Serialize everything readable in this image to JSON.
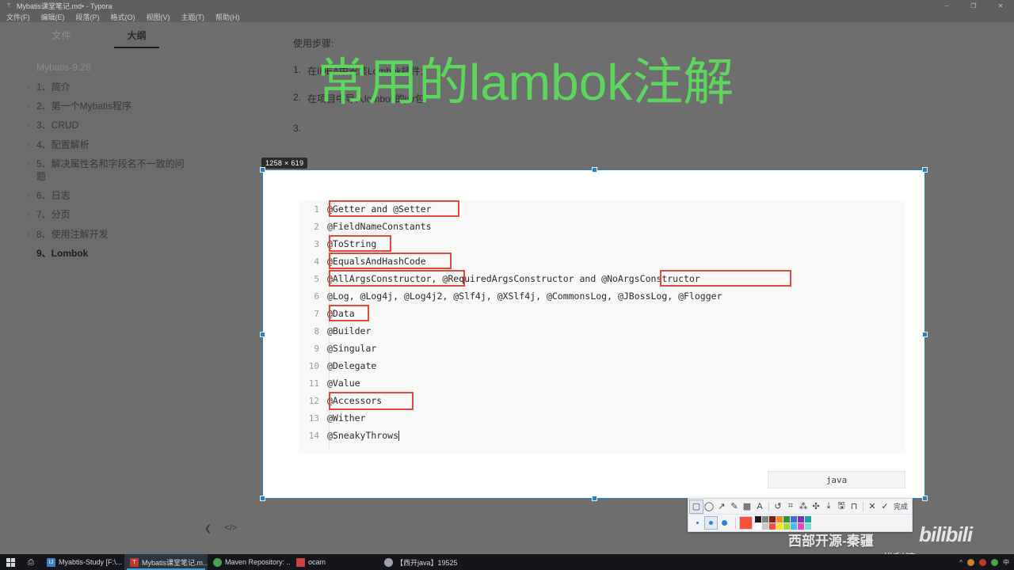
{
  "window": {
    "title": "Mybatis课堂笔记.md• - Typora",
    "app_icon": "typora-icon",
    "minimize": "–",
    "maximize": "❐",
    "close": "✕",
    "menu": [
      "文件(F)",
      "编辑(E)",
      "段落(P)",
      "格式(O)",
      "视图(V)",
      "主题(T)",
      "帮助(H)"
    ]
  },
  "sidebar": {
    "tabs": [
      {
        "label": "文件",
        "active": false
      },
      {
        "label": "大纲",
        "active": true
      }
    ],
    "root_label": "Mybatis-9.28",
    "items": [
      {
        "chevron": "›",
        "label": "1、简介",
        "current": false
      },
      {
        "chevron": "›",
        "label": "2、第一个Mybatis程序",
        "current": false
      },
      {
        "chevron": "›",
        "label": "3、CRUD",
        "current": false
      },
      {
        "chevron": "›",
        "label": "4、配置解析",
        "current": false
      },
      {
        "chevron": "›",
        "label": "5、解决属性名和字段名不一致的问题",
        "current": false
      },
      {
        "chevron": "›",
        "label": "6、日志",
        "current": false
      },
      {
        "chevron": "›",
        "label": "7、分页",
        "current": false
      },
      {
        "chevron": "›",
        "label": "8、使用注解开发",
        "current": false
      },
      {
        "chevron": "",
        "label": "9、Lombok",
        "current": true
      }
    ]
  },
  "document": {
    "heading": "使用步骤:",
    "steps": [
      {
        "num": "1.",
        "text": "在IDEA中安装Lombok插件;"
      },
      {
        "num": "2.",
        "text": "在项目中导入lombok的jar包"
      },
      {
        "num": "3.",
        "text": ""
      }
    ]
  },
  "status_bar": {
    "back_icon": "chevron-left-icon",
    "source_icon": "source-code-icon"
  },
  "overlay": {
    "green_text": "常用的lambok注解",
    "green_color": "#5cd65c"
  },
  "capture": {
    "dimension_badge": "1258 × 619",
    "accent_color": "#2a7fc9"
  },
  "code_block": {
    "language": "java",
    "lines": [
      {
        "n": "1",
        "text": "@Getter and @Setter",
        "highlight": true
      },
      {
        "n": "2",
        "text": "@FieldNameConstants",
        "highlight": false
      },
      {
        "n": "3",
        "text": "@ToString",
        "highlight": true
      },
      {
        "n": "4",
        "text": "@EqualsAndHashCode",
        "highlight": true
      },
      {
        "n": "5",
        "text": "@AllArgsConstructor, @RequiredArgsConstructor and @NoArgsConstructor",
        "highlight": true
      },
      {
        "n": "6",
        "text": "@Log, @Log4j, @Log4j2, @Slf4j, @XSlf4j, @CommonsLog, @JBossLog, @Flogger",
        "highlight": false
      },
      {
        "n": "7",
        "text": "@Data",
        "highlight": true
      },
      {
        "n": "8",
        "text": "@Builder",
        "highlight": false
      },
      {
        "n": "9",
        "text": "@Singular",
        "highlight": false
      },
      {
        "n": "10",
        "text": "@Delegate",
        "highlight": false
      },
      {
        "n": "11",
        "text": "@Value",
        "highlight": false
      },
      {
        "n": "12",
        "text": "@Accessors",
        "highlight": true
      },
      {
        "n": "13",
        "text": "@Wither",
        "highlight": false
      },
      {
        "n": "14",
        "text": "@SneakyThrows",
        "highlight": false
      }
    ],
    "annotation_color": "#e04a3a"
  },
  "annotation_toolbar": {
    "tools": [
      {
        "icon": "▢",
        "name": "rectangle-tool",
        "selected": true,
        "badge": false
      },
      {
        "icon": "◯",
        "name": "ellipse-tool",
        "selected": false,
        "badge": false
      },
      {
        "icon": "↗",
        "name": "arrow-tool",
        "selected": false,
        "badge": false
      },
      {
        "icon": "✎",
        "name": "pen-tool",
        "selected": false,
        "badge": false
      },
      {
        "icon": "▩",
        "name": "mosaic-tool",
        "selected": false,
        "badge": false
      },
      {
        "icon": "A",
        "name": "text-tool",
        "selected": false,
        "badge": false
      }
    ],
    "tools2": [
      {
        "icon": "↺",
        "name": "undo-tool",
        "selected": false,
        "badge": false
      },
      {
        "icon": "⌗",
        "name": "ocr-tool",
        "selected": false,
        "badge": true
      },
      {
        "icon": "⁂",
        "name": "translate-tool",
        "selected": false,
        "badge": true
      },
      {
        "icon": "✣",
        "name": "search-tool",
        "selected": false,
        "badge": true
      },
      {
        "icon": "⤓",
        "name": "download-tool",
        "selected": false,
        "badge": false
      },
      {
        "icon": "🖫",
        "name": "save-tool",
        "selected": false,
        "badge": false
      },
      {
        "icon": "⊓",
        "name": "pin-tool",
        "selected": false,
        "badge": false
      }
    ],
    "close_icon": "✕",
    "check_icon": "✓",
    "done_label": "完成",
    "brush_sizes": [
      {
        "name": "brush-size-small",
        "px": 3,
        "active": false
      },
      {
        "name": "brush-size-medium",
        "px": 5,
        "active": true
      },
      {
        "name": "brush-size-large",
        "px": 7,
        "active": false
      }
    ],
    "current_color": "#f4503c",
    "swatch_colors_row1": [
      "#1a1a1a",
      "#808080",
      "#8b1a12",
      "#f08a2a",
      "#2f8f3e",
      "#3f6fd0",
      "#7b30b8",
      "#1aa5a5"
    ],
    "swatch_colors_row2": [
      "#ffffff",
      "#c9c9c9",
      "#f4503c",
      "#f2e520",
      "#a8d832",
      "#3fc0f0",
      "#f040c8",
      "#7ae0d0"
    ]
  },
  "watermarks": {
    "author": "西部开源-秦疆",
    "site": "bilibili",
    "csdn": "CSDN@优利德"
  },
  "taskbar": {
    "start_icon": "windows-start-icon",
    "taskview_icon": "task-view-icon",
    "apps": [
      {
        "label": "Myabtis-Study [F:\\...",
        "icon": "idea-icon",
        "color": "#3b7fc4",
        "active": false
      },
      {
        "label": "Mybatis课堂笔记.m...",
        "icon": "typora-icon",
        "color": "#c0392b",
        "active": true
      },
      {
        "label": "Maven Repository: ...",
        "icon": "chrome-icon",
        "color": "#4aa24a",
        "active": false
      },
      {
        "label": "ocam",
        "icon": "ocam-icon",
        "color": "#d04040",
        "active": false
      },
      {
        "label": "【西开java】19525",
        "icon": "bili-icon",
        "color": "#9aa4ae",
        "active": false
      }
    ],
    "tray": [
      "^",
      "◎",
      "♟",
      "●",
      "中"
    ]
  }
}
